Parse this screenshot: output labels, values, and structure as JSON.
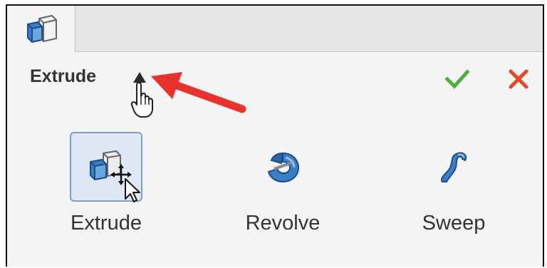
{
  "panel": {
    "title": "Extrude"
  },
  "tools": [
    {
      "label": "Extrude",
      "icon": "extrude-icon",
      "selected": true
    },
    {
      "label": "Revolve",
      "icon": "revolve-icon",
      "selected": false
    },
    {
      "label": "Sweep",
      "icon": "sweep-icon",
      "selected": false
    }
  ],
  "colors": {
    "ok": "#4caf3a",
    "cancel": "#e04a2a",
    "accent_blue": "#3a7ec8",
    "annotation_arrow": "#e8322b"
  }
}
